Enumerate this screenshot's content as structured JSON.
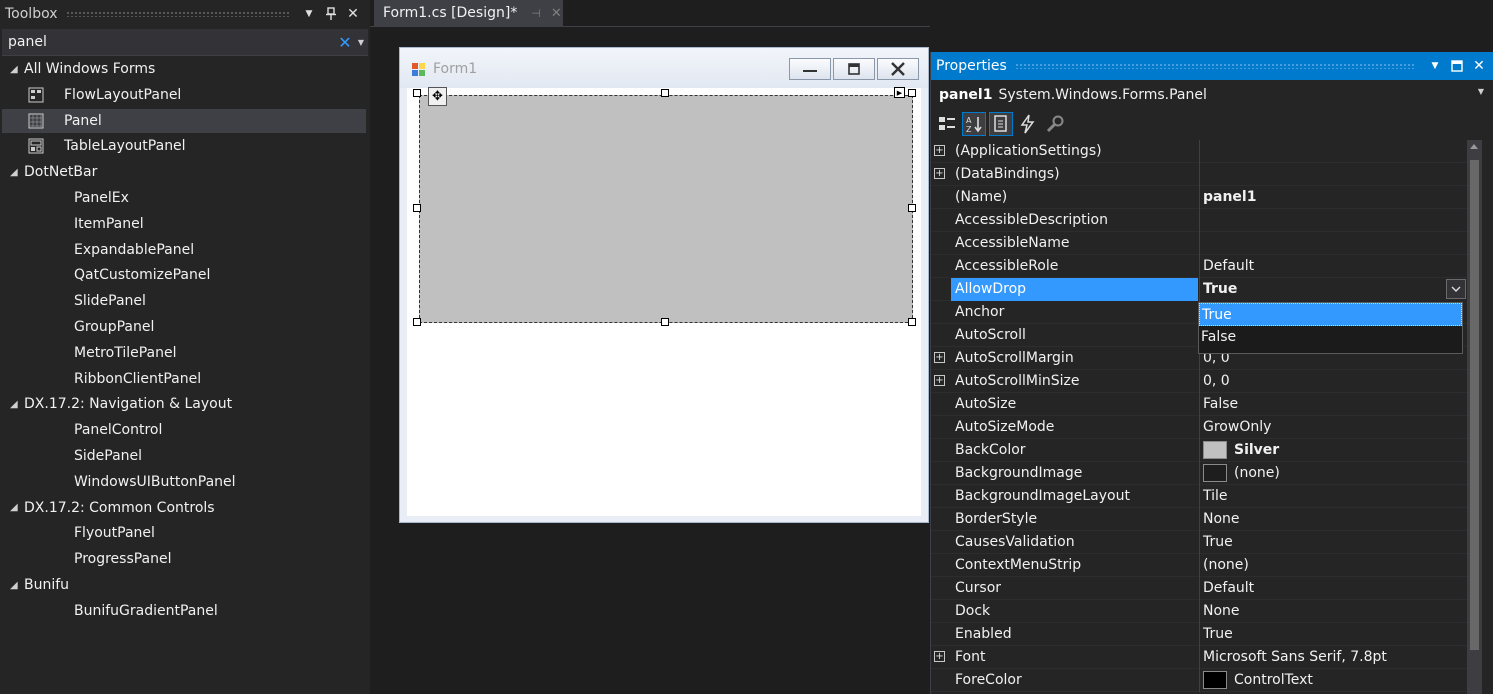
{
  "toolbox": {
    "title": "Toolbox",
    "search_value": "panel",
    "categories": [
      {
        "label": "All Windows Forms",
        "items": [
          "FlowLayoutPanel",
          "Panel",
          "TableLayoutPanel"
        ]
      },
      {
        "label": "DotNetBar",
        "items": [
          "PanelEx",
          "ItemPanel",
          "ExpandablePanel",
          "QatCustomizePanel",
          "SlidePanel",
          "GroupPanel",
          "MetroTilePanel",
          "RibbonClientPanel"
        ]
      },
      {
        "label": "DX.17.2: Navigation & Layout",
        "items": [
          "PanelControl",
          "SidePanel",
          "WindowsUIButtonPanel"
        ]
      },
      {
        "label": "DX.17.2: Common Controls",
        "items": [
          "FlyoutPanel",
          "ProgressPanel"
        ]
      },
      {
        "label": "Bunifu",
        "items": [
          "BunifuGradientPanel"
        ]
      }
    ],
    "selected_item": "Panel"
  },
  "document_tab": {
    "label": "Form1.cs [Design]*"
  },
  "designer": {
    "form_title": "Form1"
  },
  "properties": {
    "title": "Properties",
    "object_name": "panel1",
    "object_type": "System.Windows.Forms.Panel",
    "rows": [
      {
        "name": "(ApplicationSettings)",
        "value": "",
        "expandable": true
      },
      {
        "name": "(DataBindings)",
        "value": "",
        "expandable": true
      },
      {
        "name": "(Name)",
        "value": "panel1",
        "bold": true
      },
      {
        "name": "AccessibleDescription",
        "value": ""
      },
      {
        "name": "AccessibleName",
        "value": ""
      },
      {
        "name": "AccessibleRole",
        "value": "Default"
      },
      {
        "name": "AllowDrop",
        "value": "True",
        "selected": true
      },
      {
        "name": "Anchor",
        "value": ""
      },
      {
        "name": "AutoScroll",
        "value": ""
      },
      {
        "name": "AutoScrollMargin",
        "value": "0, 0",
        "expandable": true
      },
      {
        "name": "AutoScrollMinSize",
        "value": "0, 0",
        "expandable": true
      },
      {
        "name": "AutoSize",
        "value": "False"
      },
      {
        "name": "AutoSizeMode",
        "value": "GrowOnly"
      },
      {
        "name": "BackColor",
        "value": "Silver",
        "bold": true,
        "swatch": "#c0c0c0"
      },
      {
        "name": "BackgroundImage",
        "value": "(none)",
        "swatch": "#1e1e1e"
      },
      {
        "name": "BackgroundImageLayout",
        "value": "Tile"
      },
      {
        "name": "BorderStyle",
        "value": "None"
      },
      {
        "name": "CausesValidation",
        "value": "True"
      },
      {
        "name": "ContextMenuStrip",
        "value": "(none)"
      },
      {
        "name": "Cursor",
        "value": "Default"
      },
      {
        "name": "Dock",
        "value": "None"
      },
      {
        "name": "Enabled",
        "value": "True"
      },
      {
        "name": "Font",
        "value": "Microsoft Sans Serif, 7.8pt",
        "expandable": true
      },
      {
        "name": "ForeColor",
        "value": "ControlText",
        "swatch": "#000000"
      }
    ],
    "dropdown_options": [
      "True",
      "False"
    ],
    "dropdown_highlighted": "True"
  },
  "colors": {
    "accent": "#007acc",
    "selection": "#3399ff",
    "panel_back": "#c0c0c0"
  }
}
